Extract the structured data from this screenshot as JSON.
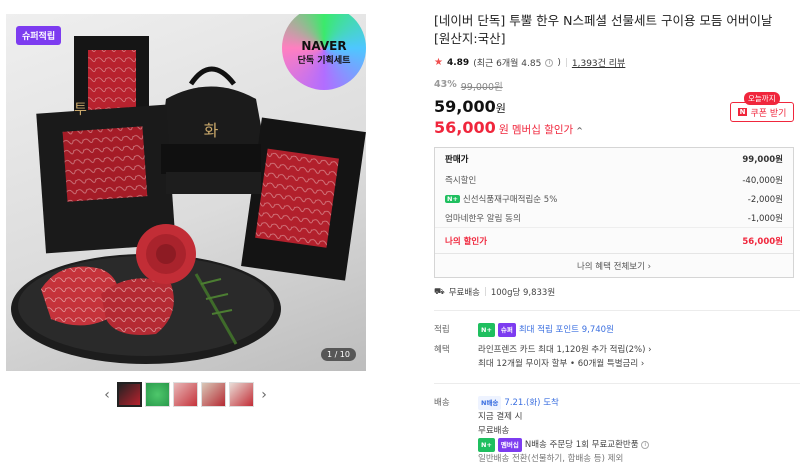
{
  "gallery": {
    "badge_label": "슈퍼적립",
    "naver_line1": "NAVER",
    "naver_line2": "단독 기획세트",
    "page_counter": "1 / 10",
    "prev_arrow": "‹",
    "next_arrow": "›",
    "thumb_count": 5
  },
  "product": {
    "title": "[네이버 단독] 투뿔 한우 N스페셜 선물세트 구이용 모듬 어버이날 [원산지:국산]",
    "rating": "4.89",
    "rating_detail": "(최근 6개월 4.85",
    "review_count": "1,393건 리뷰",
    "discount_pct": "43%",
    "original_price": "99,000원",
    "price": "59,000",
    "price_unit": "원",
    "member_price": "56,000",
    "member_unit": "원",
    "member_label": "멤버십 할인가",
    "coupon_tag": "오늘까지",
    "coupon_label": "쿠폰 받기"
  },
  "breakdown": {
    "rows": [
      {
        "label": "판매가",
        "value": "99,000원"
      },
      {
        "label": "즉시할인",
        "value": "-40,000원"
      },
      {
        "label": "신선식품재구매적립순 5%",
        "value": "-2,000원"
      },
      {
        "label": "엄마네한우 알림 동의",
        "value": "-1,000원"
      }
    ],
    "mine_label": "나의 할인가",
    "mine_value": "56,000원",
    "more_label": "나의 혜택 전체보기 ›",
    "npay_tag": "N+"
  },
  "shipping": {
    "label": "무료배송",
    "per_unit": "100g당 9,833원"
  },
  "points": {
    "key": "적립",
    "tag": "N+",
    "tag2": "슈퍼",
    "value": "최대 적립 포인트 9,740원"
  },
  "benefit": {
    "key": "혜택",
    "line1": "라인프렌즈 카드 최대 1,120원 추가 적립(2%) ›",
    "line2": "최대 12개월 무이자 할부 • 60개월 특별금리 ›"
  },
  "delivery": {
    "key": "배송",
    "tag": "N배송",
    "arrival": "7.21.(화) 도착",
    "line1": "지금 결제 시",
    "line2": "무료배송",
    "np_tag": "N+",
    "pu_tag": "멤버십",
    "line3": "N배송 주문당 1회 무료교환반품",
    "line4": "일반배송 전환(선물하기, 합배송 등) 제외"
  }
}
